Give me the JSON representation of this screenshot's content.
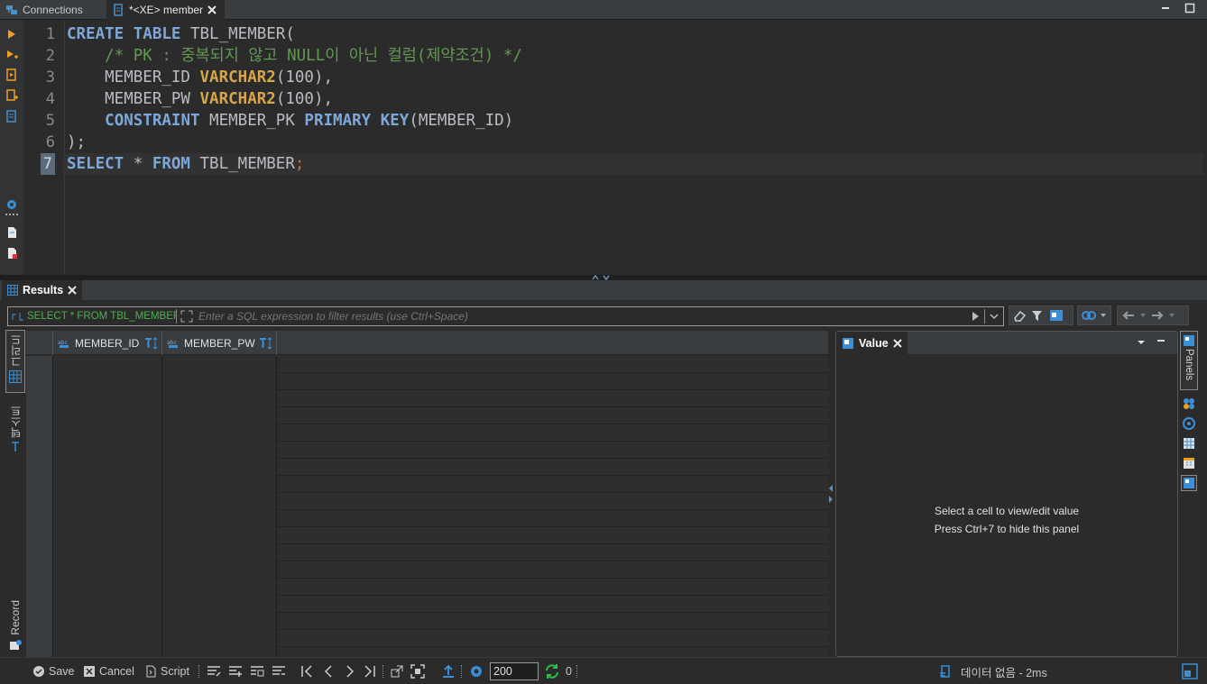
{
  "top_tabs": [
    {
      "label": "Connections"
    },
    {
      "label": "*<XE> member"
    }
  ],
  "editor": {
    "line_numbers": [
      "1",
      "2",
      "3",
      "4",
      "5",
      "6",
      "7"
    ],
    "current_line": "7",
    "lines": [
      [
        {
          "t": "CREATE TABLE",
          "c": "kw"
        },
        {
          "t": " TBL_MEMBER(",
          "c": "pu"
        }
      ],
      [
        {
          "t": "    ",
          "c": "pu"
        },
        {
          "t": "/* PK : 중복되지 않고 NULL이 아닌 컬럼(제약조건) */",
          "c": "cm"
        }
      ],
      [
        {
          "t": "    MEMBER_ID ",
          "c": "pu"
        },
        {
          "t": "VARCHAR2",
          "c": "ty"
        },
        {
          "t": "(100),",
          "c": "pu"
        }
      ],
      [
        {
          "t": "    MEMBER_PW ",
          "c": "pu"
        },
        {
          "t": "VARCHAR2",
          "c": "ty"
        },
        {
          "t": "(100),",
          "c": "pu"
        }
      ],
      [
        {
          "t": "    ",
          "c": "pu"
        },
        {
          "t": "CONSTRAINT",
          "c": "kw"
        },
        {
          "t": " MEMBER_PK ",
          "c": "pu"
        },
        {
          "t": "PRIMARY KEY",
          "c": "kw"
        },
        {
          "t": "(MEMBER_ID)",
          "c": "pu"
        }
      ],
      [
        {
          "t": ");",
          "c": "pu"
        }
      ],
      [
        {
          "t": "SELECT",
          "c": "kw"
        },
        {
          "t": " * ",
          "c": "pu"
        },
        {
          "t": "FROM",
          "c": "kw"
        },
        {
          "t": " TBL_MEMBER",
          "c": "pu"
        },
        {
          "t": ";",
          "c": "sem"
        }
      ]
    ]
  },
  "results": {
    "tab_label": "Results",
    "filter": {
      "history_text": "SELECT * FROM TBL_MEMBER",
      "placeholder": "Enter a SQL expression to filter results (use Ctrl+Space)"
    },
    "left_tabs": {
      "grid": "그리드",
      "text": "텍스트",
      "record": "Record"
    },
    "columns": [
      "MEMBER_ID",
      "MEMBER_PW"
    ],
    "rows": []
  },
  "value_panel": {
    "tab_label": "Value",
    "hint_line1": "Select a cell to view/edit value",
    "hint_line2": "Press Ctrl+7 to hide this panel",
    "side_label": "Panels"
  },
  "bottom_bar": {
    "save_label": "Save",
    "cancel_label": "Cancel",
    "script_label": "Script",
    "fetch_size": "200",
    "refresh_count": "0",
    "status_text": "데이터 없음 - 2ms"
  },
  "colors": {
    "keyword": "#7da7d8",
    "type": "#d7a64b",
    "comment": "#629755",
    "accent": "#3b8fd6",
    "filter_history": "#4caf50"
  }
}
